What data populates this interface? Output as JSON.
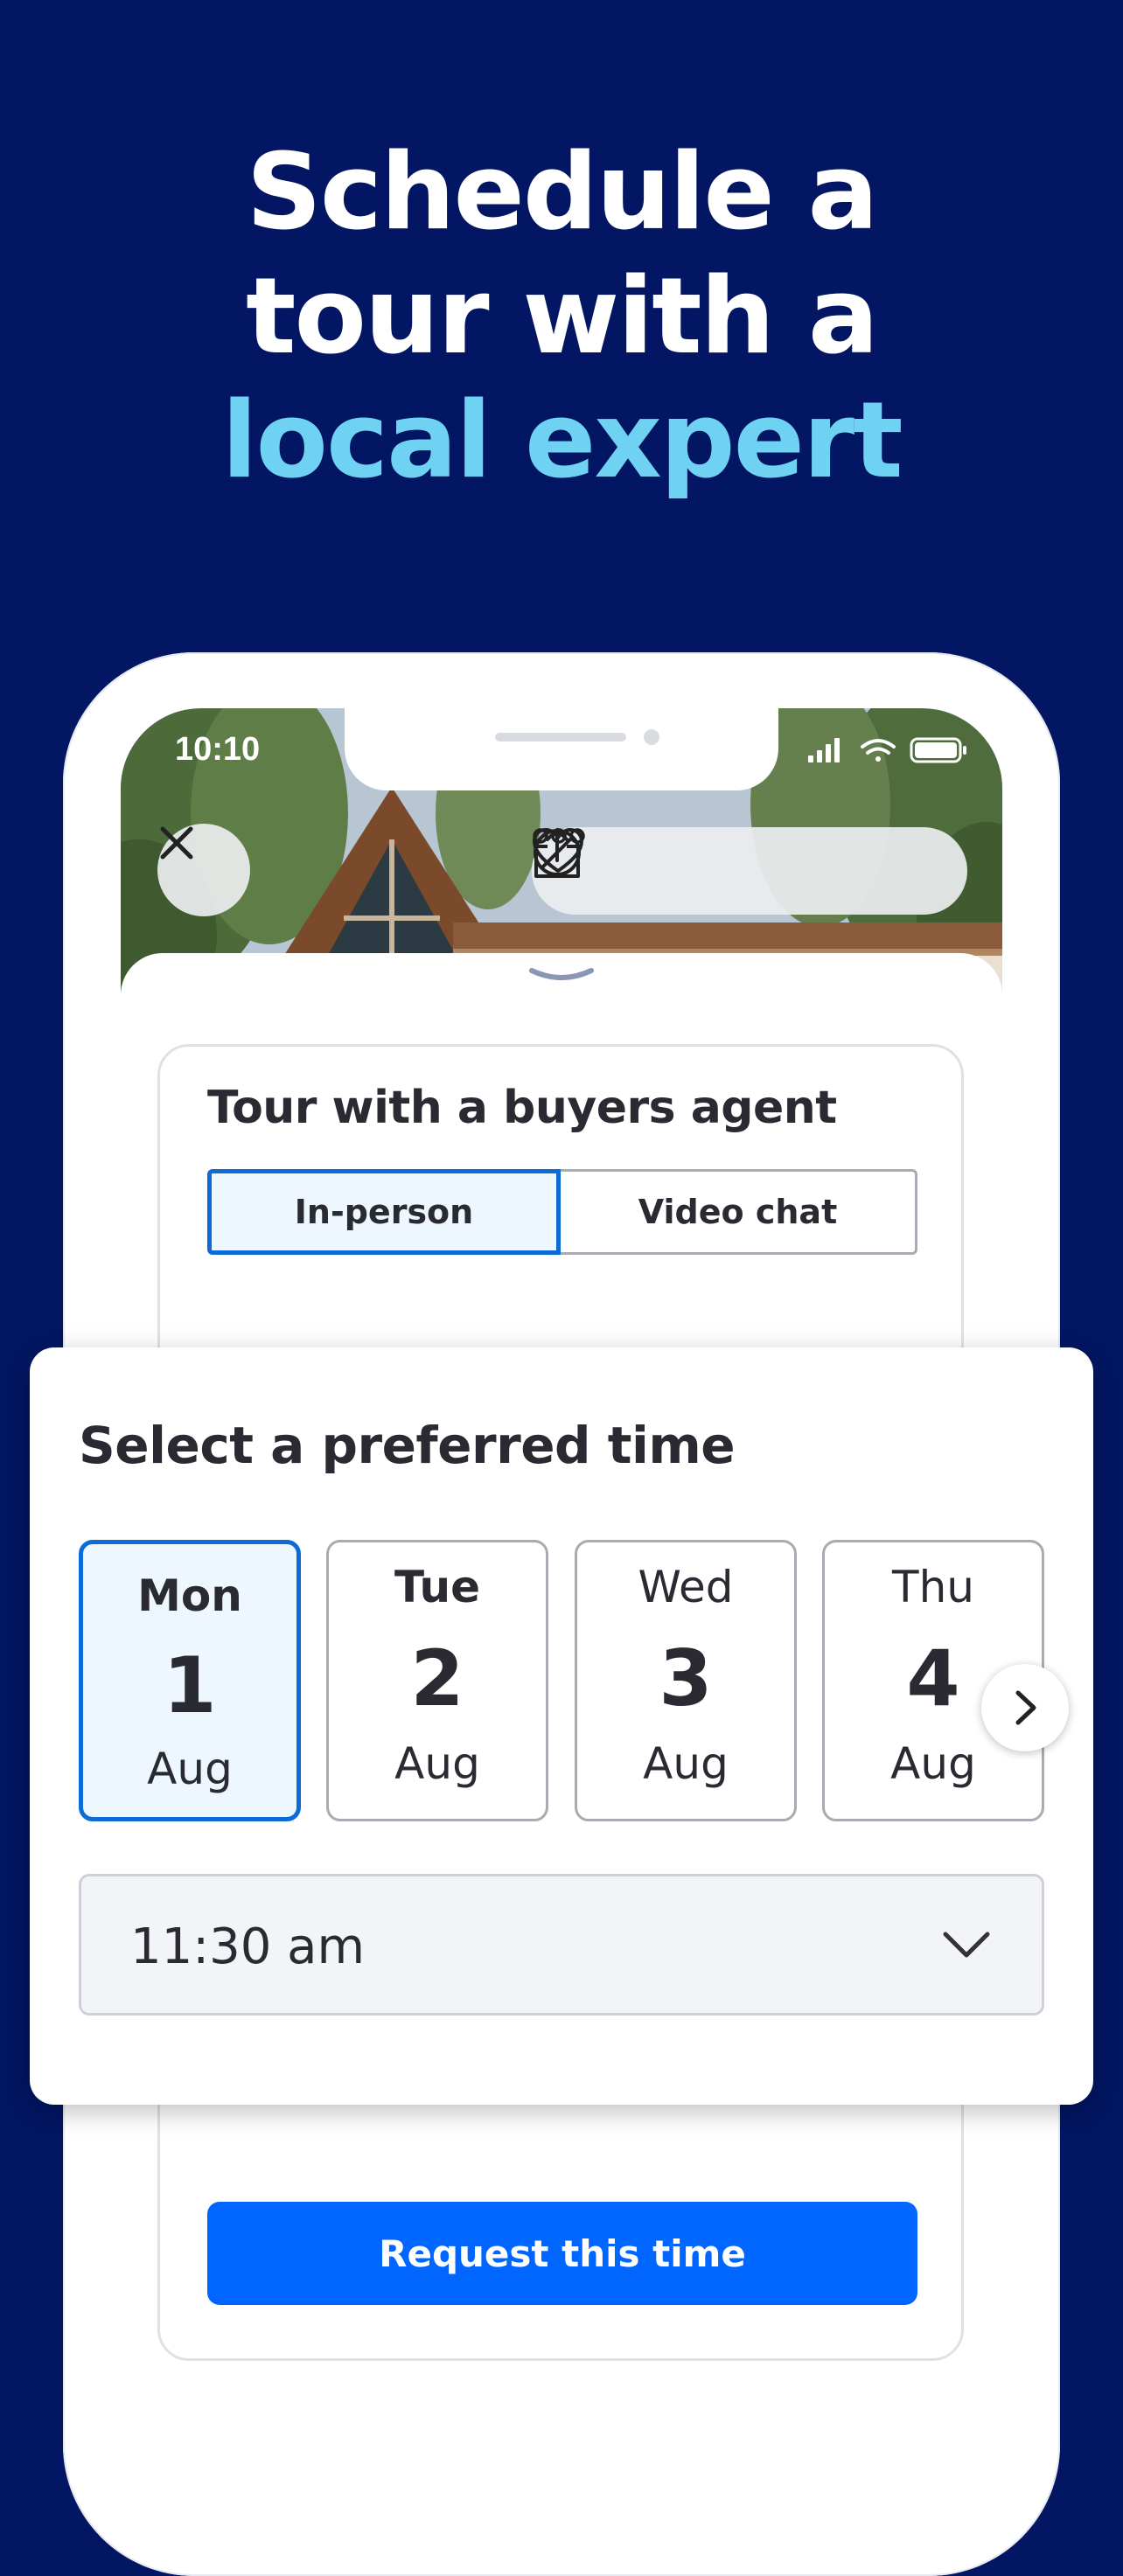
{
  "headline": {
    "line1": "Schedule a",
    "line2": "tour with a",
    "line3": "local expert"
  },
  "colors": {
    "background": "#021663",
    "accent_text": "#6fd2f3",
    "primary_button": "#0066ff",
    "selection_border": "#0d6bd8"
  },
  "status_bar": {
    "time": "10:10",
    "icons": [
      "signal-icon",
      "wifi-icon",
      "battery-icon"
    ]
  },
  "photo_actions": {
    "close": "close-icon",
    "favorite": "heart-icon",
    "share": "share-icon",
    "hide": "block-icon",
    "more": "more-icon"
  },
  "tour_card": {
    "title": "Tour with a buyers agent",
    "segments": [
      {
        "label": "In-person",
        "selected": true
      },
      {
        "label": "Video chat",
        "selected": false
      }
    ],
    "request_button": "Request this time"
  },
  "time_picker": {
    "title": "Select a preferred time",
    "days": [
      {
        "dow": "Mon",
        "day": "1",
        "month": "Aug",
        "selected": true
      },
      {
        "dow": "Tue",
        "day": "2",
        "month": "Aug",
        "selected": false
      },
      {
        "dow": "Wed",
        "day": "3",
        "month": "Aug",
        "selected": false
      },
      {
        "dow": "Thu",
        "day": "4",
        "month": "Aug",
        "selected": false
      }
    ],
    "time_value": "11:30 am"
  }
}
